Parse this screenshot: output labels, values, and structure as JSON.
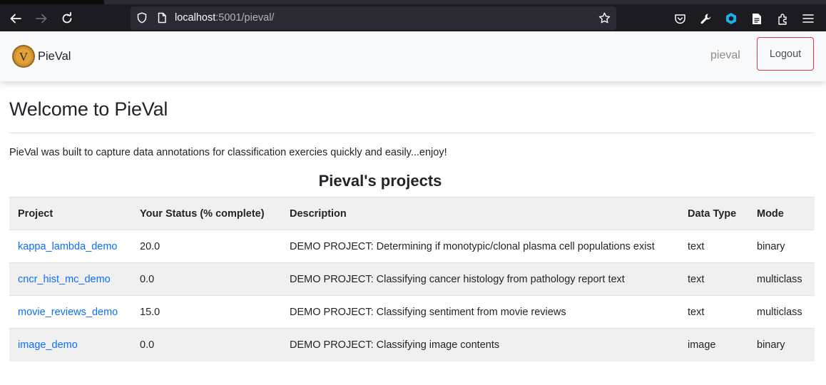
{
  "browser": {
    "url_host": "localhost",
    "url_rest": ":5001/pieval/"
  },
  "navbar": {
    "brand_name": "PieVal",
    "logo_letter": "V",
    "user": "pieval",
    "logout_label": "Logout"
  },
  "page": {
    "title": "Welcome to PieVal",
    "intro": "PieVal was built to capture data annotations for classification exercies quickly and easily...enjoy!",
    "section_title": "Pieval's projects"
  },
  "table": {
    "headers": [
      "Project",
      "Your Status (% complete)",
      "Description",
      "Data Type",
      "Mode"
    ],
    "rows": [
      {
        "project": "kappa_lambda_demo",
        "status": "20.0",
        "description": "DEMO PROJECT: Determining if monotypic/clonal plasma cell populations exist",
        "data_type": "text",
        "mode": "binary"
      },
      {
        "project": "cncr_hist_mc_demo",
        "status": "0.0",
        "description": "DEMO PROJECT: Classifying cancer histology from pathology report text",
        "data_type": "text",
        "mode": "multiclass"
      },
      {
        "project": "movie_reviews_demo",
        "status": "15.0",
        "description": "DEMO PROJECT: Classifying sentiment from movie reviews",
        "data_type": "text",
        "mode": "multiclass"
      },
      {
        "project": "image_demo",
        "status": "0.0",
        "description": "DEMO PROJECT: Classifying image contents",
        "data_type": "image",
        "mode": "binary"
      }
    ]
  },
  "colors": {
    "link": "#0d6efd",
    "logout_border": "#dc3545",
    "logo_gold": "#d4902a"
  },
  "icons": [
    "back-arrow-icon",
    "forward-arrow-icon",
    "reload-icon",
    "shield-icon",
    "page-icon",
    "bookmark-star-icon",
    "pocket-icon",
    "wrench-icon",
    "extension-cube-icon",
    "reader-icon",
    "extensions-icon",
    "menu-icon"
  ]
}
